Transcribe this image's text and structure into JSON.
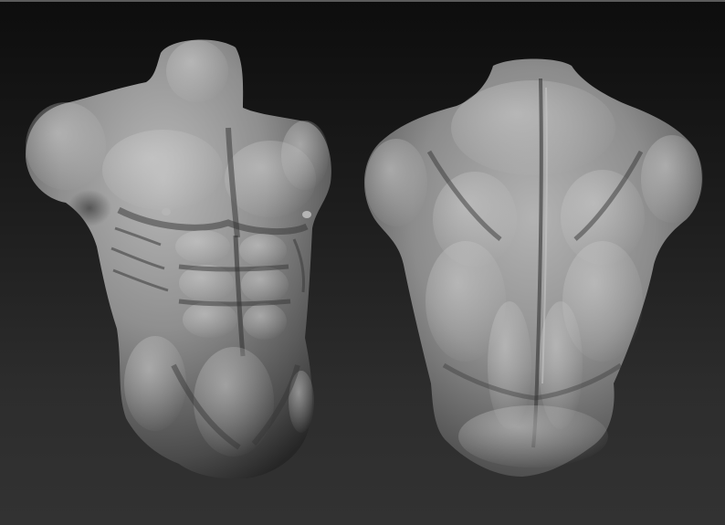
{
  "canvas": {
    "background_top": "#0d0d0d",
    "background_bottom": "#323232",
    "clay_color": "#8a8a8a"
  },
  "figures": [
    {
      "id": "front",
      "subject": "torso-front-icon"
    },
    {
      "id": "back",
      "subject": "torso-back-icon"
    }
  ]
}
